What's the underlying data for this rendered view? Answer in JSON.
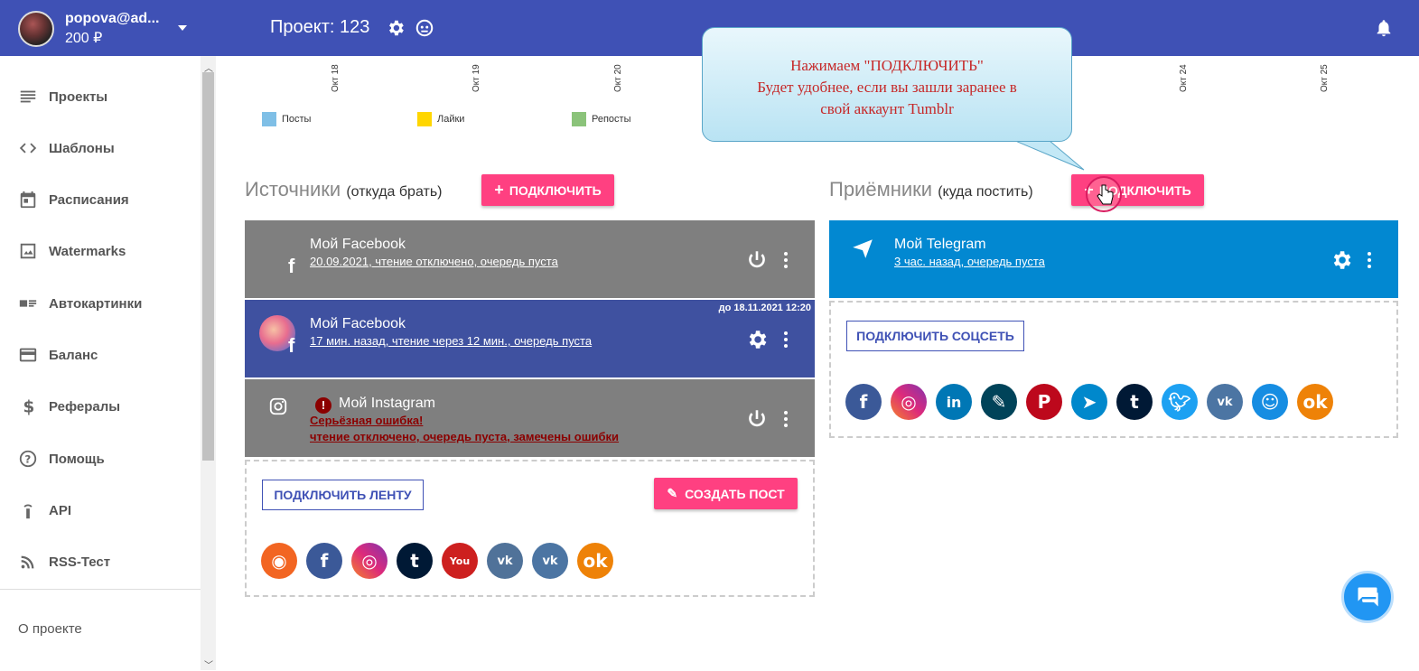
{
  "header": {
    "user_email": "popova@ad...",
    "balance": "200 ₽",
    "project": "Проект: 123"
  },
  "sidebar": {
    "items": [
      {
        "label": "Проекты",
        "icon": "list-icon"
      },
      {
        "label": "Шаблоны",
        "icon": "code-icon"
      },
      {
        "label": "Расписания",
        "icon": "calendar-icon"
      },
      {
        "label": "Watermarks",
        "icon": "image-icon"
      },
      {
        "label": "Автокартинки",
        "icon": "card-icon"
      },
      {
        "label": "Баланс",
        "icon": "credit-card-icon"
      },
      {
        "label": "Рефералы",
        "icon": "dollar-icon"
      },
      {
        "label": "Помощь",
        "icon": "help-icon"
      },
      {
        "label": "API",
        "icon": "antenna-icon"
      },
      {
        "label": "RSS-Тест",
        "icon": "rss-icon"
      }
    ],
    "about": "О проекте"
  },
  "chart": {
    "x_labels": [
      "Окт 18",
      "Окт 19",
      "Окт 20",
      "Окт 24",
      "Окт 25"
    ],
    "legend": [
      {
        "label": "Посты",
        "color": "#7fbfe6"
      },
      {
        "label": "Лайки",
        "color": "#ffd600"
      },
      {
        "label": "Репосты",
        "color": "#8bc37a"
      }
    ]
  },
  "tooltip": {
    "line1": "Нажимаем \"ПОДКЛЮЧИТЬ\"",
    "line2": "Будет удобнее, если вы зашли заранее в",
    "line3": "свой аккаунт Tumblr"
  },
  "sources": {
    "title": "Источники",
    "subtitle": "(откуда брать)",
    "connect_label": "ПОДКЛЮЧИТЬ",
    "cards": [
      {
        "name": "Мой Facebook",
        "status": "20.09.2021, чтение отключено, очередь пуста"
      },
      {
        "name": "Мой Facebook",
        "status": "17 мин. назад, чтение через 12 мин., очередь пуста",
        "badge": "до 18.11.2021 12:20"
      },
      {
        "name": "Мой Instagram",
        "error": "Серьёзная ошибка!",
        "status": "чтение отключено, очередь пуста, замечены ошибки"
      }
    ],
    "connect_feed_label": "ПОДКЛЮЧИТЬ ЛЕНТУ",
    "create_post_label": "СОЗДАТЬ ПОСТ",
    "networks": [
      "rss",
      "facebook",
      "instagram",
      "tumblr",
      "youtube",
      "vk-messages",
      "vk",
      "odnoklassniki"
    ]
  },
  "receivers": {
    "title": "Приёмники",
    "subtitle": "(куда постить)",
    "connect_label": "ПОДКЛЮЧИТЬ",
    "card": {
      "name": "Мой Telegram",
      "status": "3 час. назад, очередь пуста"
    },
    "connect_social_label": "ПОДКЛЮЧИТЬ СОЦСЕТЬ",
    "networks": [
      "facebook",
      "instagram",
      "linkedin",
      "livejournal",
      "pinterest",
      "telegram",
      "tumblr",
      "twitter",
      "vk",
      "mail-ru",
      "odnoklassniki"
    ]
  }
}
